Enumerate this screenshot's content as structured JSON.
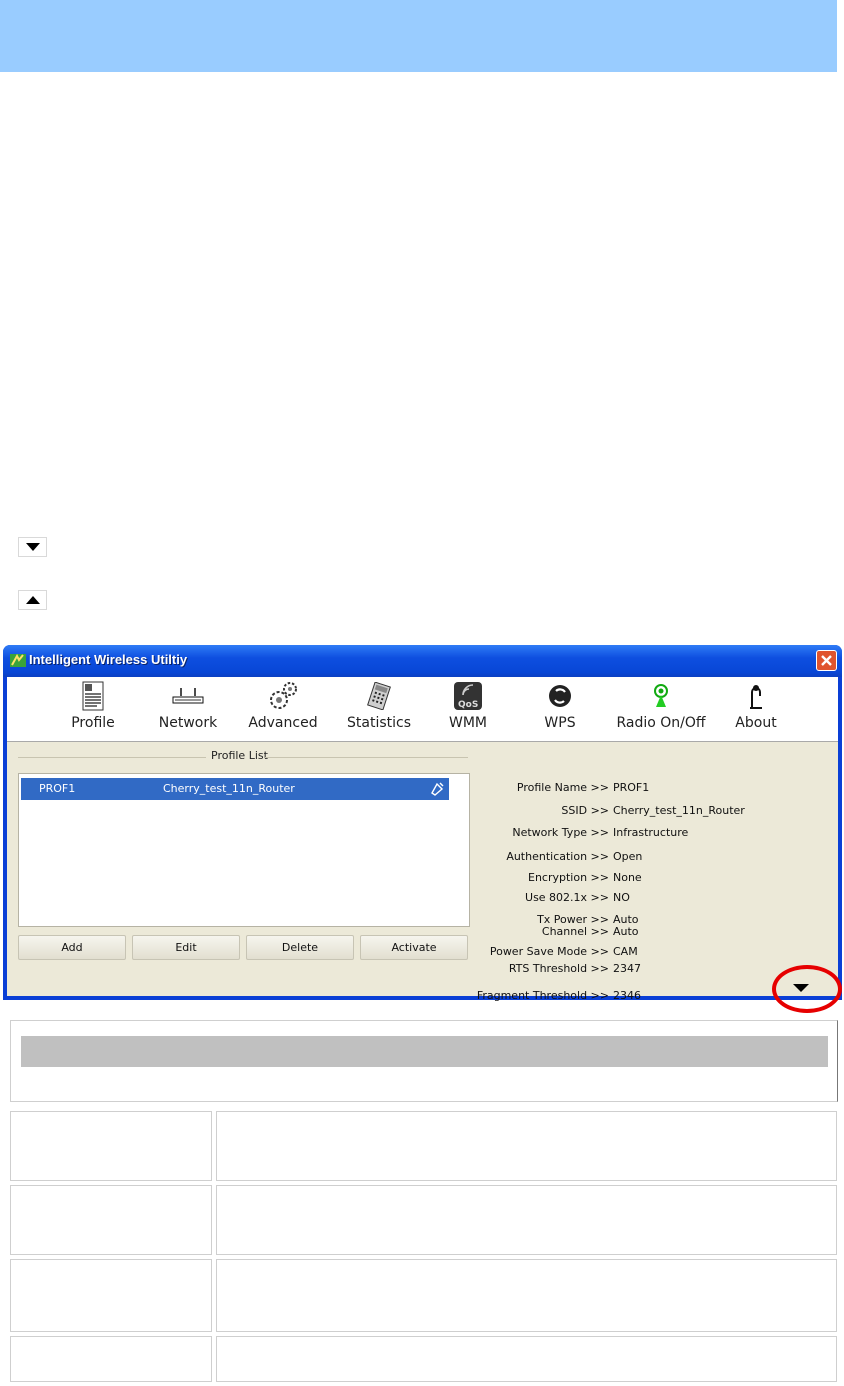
{
  "window": {
    "title": "Intelligent Wireless Utiltiy"
  },
  "toolbar": {
    "items": [
      {
        "label": "Profile",
        "icon": "profile-icon"
      },
      {
        "label": "Network",
        "icon": "router-icon"
      },
      {
        "label": "Advanced",
        "icon": "gears-icon"
      },
      {
        "label": "Statistics",
        "icon": "calculator-icon"
      },
      {
        "label": "WMM",
        "icon": "qos-icon"
      },
      {
        "label": "WPS",
        "icon": "wps-icon"
      },
      {
        "label": "Radio On/Off",
        "icon": "radio-icon"
      },
      {
        "label": "About",
        "icon": "about-icon"
      }
    ]
  },
  "profile_list": {
    "group_title": "Profile List",
    "rows": [
      {
        "profile": "PROF1",
        "ssid": "Cherry_test_11n_Router"
      }
    ],
    "buttons": {
      "add": "Add",
      "edit": "Edit",
      "delete": "Delete",
      "activate": "Activate"
    }
  },
  "details": [
    {
      "key": "Profile Name >>",
      "value": "PROF1"
    },
    {
      "key": "SSID >>",
      "value": "Cherry_test_11n_Router"
    },
    {
      "key": "Network Type >>",
      "value": "Infrastructure"
    },
    {
      "key": "Authentication >>",
      "value": "Open"
    },
    {
      "key": "Encryption >>",
      "value": "None"
    },
    {
      "key": "Use 802.1x >>",
      "value": "NO"
    },
    {
      "key": "Tx Power >>",
      "value": "Auto"
    },
    {
      "key": "Channel >>",
      "value": "Auto"
    },
    {
      "key": "Power Save Mode >>",
      "value": "CAM"
    },
    {
      "key": "RTS Threshold >>",
      "value": "2347"
    },
    {
      "key": "Fragment Threshold >>",
      "value": "2346"
    }
  ],
  "colors": {
    "banner": "#99ccff",
    "selection": "#316ac5",
    "highlight_ring": "#e60000"
  }
}
